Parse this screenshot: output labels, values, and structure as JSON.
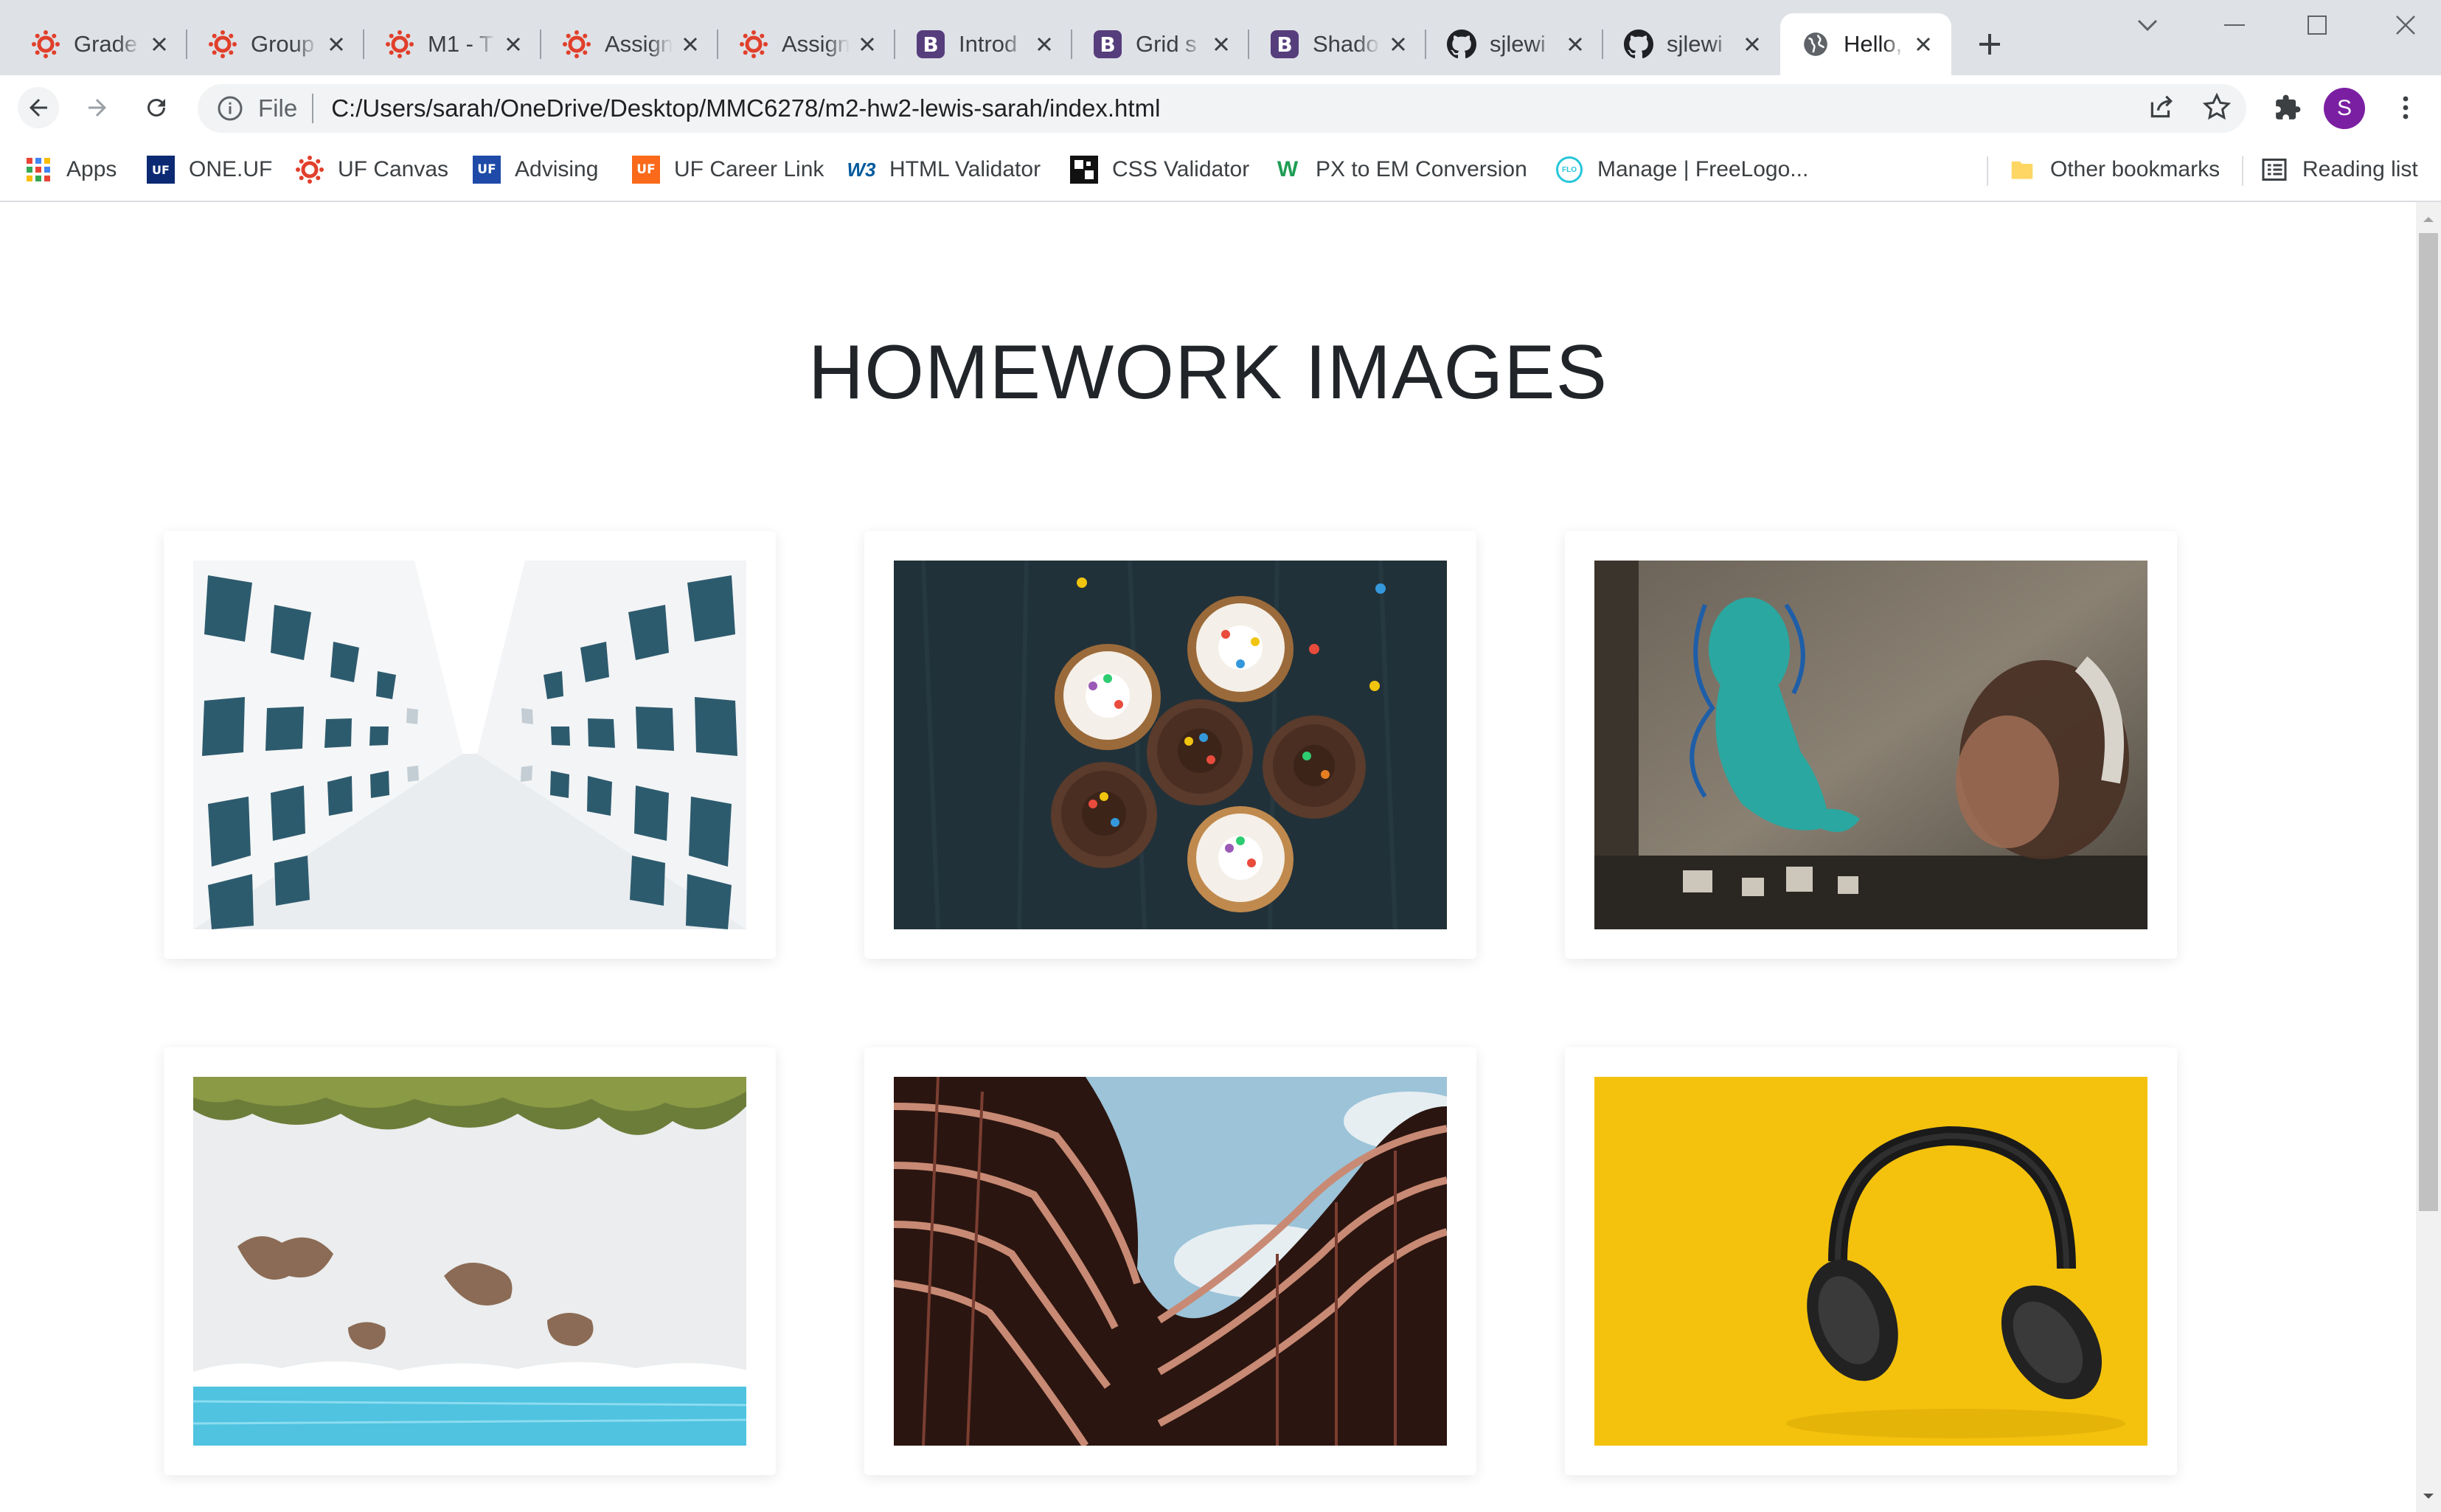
{
  "tabs": [
    {
      "title": "Grade",
      "favicon": "canvas-icon"
    },
    {
      "title": "Group",
      "favicon": "canvas-icon"
    },
    {
      "title": "M1 - T",
      "favicon": "canvas-icon"
    },
    {
      "title": "Assign",
      "favicon": "canvas-icon"
    },
    {
      "title": "Assign",
      "favicon": "canvas-icon"
    },
    {
      "title": "Introd",
      "favicon": "bootstrap-icon",
      "badge": "B"
    },
    {
      "title": "Grid s",
      "favicon": "bootstrap-icon",
      "badge": "B"
    },
    {
      "title": "Shado",
      "favicon": "bootstrap-icon",
      "badge": "B"
    },
    {
      "title": "sjlewi",
      "favicon": "github-icon"
    },
    {
      "title": "sjlewi",
      "favicon": "github-icon"
    },
    {
      "title": "Hello,",
      "favicon": "globe-icon",
      "active": true
    }
  ],
  "address_bar": {
    "scheme": "File",
    "url": "C:/Users/sarah/OneDrive/Desktop/MMC6278/m2-hw2-lewis-sarah/index.html"
  },
  "profile": {
    "initial": "S",
    "color": "#7b1fa2"
  },
  "bookmarks": {
    "apps": "Apps",
    "items": [
      {
        "label": "ONE.UF",
        "icon": "one-uf-icon",
        "badge": "UF"
      },
      {
        "label": "UF Canvas",
        "icon": "canvas-icon"
      },
      {
        "label": "Advising",
        "icon": "uf-icon",
        "badge": "UF"
      },
      {
        "label": "UF Career Link",
        "icon": "uf-orange-icon",
        "badge": "UF"
      },
      {
        "label": "HTML Validator",
        "icon": "w3-icon",
        "badge": "W3"
      },
      {
        "label": "CSS Validator",
        "icon": "css-validator-icon"
      },
      {
        "label": "PX to EM Conversion",
        "icon": "w-icon",
        "badge": "W"
      },
      {
        "label": "Manage | FreeLogo...",
        "icon": "flo-icon",
        "badge": "FLO"
      }
    ],
    "other": "Other bookmarks",
    "reading_list": "Reading list"
  },
  "page": {
    "heading": "HOMEWORK IMAGES",
    "images": [
      {
        "subject": "building-facade-looking-up"
      },
      {
        "subject": "cupcakes-with-sprinkles"
      },
      {
        "subject": "street-art-mural-woman-headphones"
      },
      {
        "subject": "aerial-beach-upside-down"
      },
      {
        "subject": "wavy-building-facade"
      },
      {
        "subject": "headphones-on-yellow"
      }
    ]
  },
  "colors": {
    "tab_strip": "#dee1e6",
    "omnibox": "#f1f3f4",
    "canvas_red": "#e13f2b",
    "bootstrap_purple": "#563d7c"
  }
}
